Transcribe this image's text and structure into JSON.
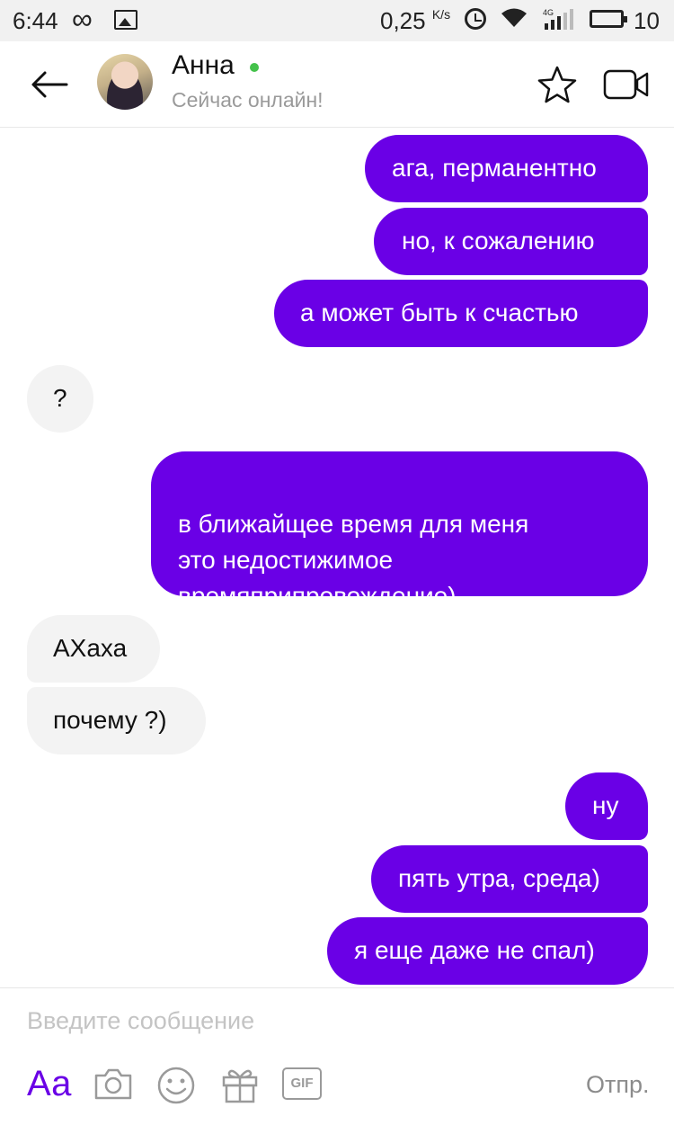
{
  "status_bar": {
    "time": "6:44",
    "speed": "0,25",
    "speed_unit": "K/s",
    "network": "4G",
    "battery": "10"
  },
  "header": {
    "contact_name": "Анна",
    "contact_status": "Сейчас онлайн!",
    "online_color": "#44c24b"
  },
  "messages": [
    {
      "dir": "out",
      "text": "ага, перманентно"
    },
    {
      "dir": "out",
      "text": "но, к сожалению"
    },
    {
      "dir": "out",
      "text": "а может быть к счастью"
    },
    {
      "dir": "in",
      "text": "?"
    },
    {
      "dir": "out",
      "text": "в ближайщее время для меня\nэто недостижимое\nвремяприпровождение)"
    },
    {
      "dir": "in",
      "text": "АХаха"
    },
    {
      "dir": "in",
      "text": "почему ?)"
    },
    {
      "dir": "out",
      "text": "ну"
    },
    {
      "dir": "out",
      "text": "пять утра, среда)"
    },
    {
      "dir": "out",
      "text": "я еще даже не спал)"
    }
  ],
  "composer": {
    "placeholder": "Введите сообщение",
    "value": "",
    "aa_label": "Аа",
    "gif_label": "GIF",
    "send_label": "Отпр."
  },
  "colors": {
    "accent": "#6a00e6",
    "incoming_bubble": "#f3f3f3"
  },
  "icons": [
    "back-arrow-icon",
    "star-icon",
    "video-camera-icon",
    "camera-icon",
    "smiley-icon",
    "gift-icon",
    "gif-icon"
  ]
}
